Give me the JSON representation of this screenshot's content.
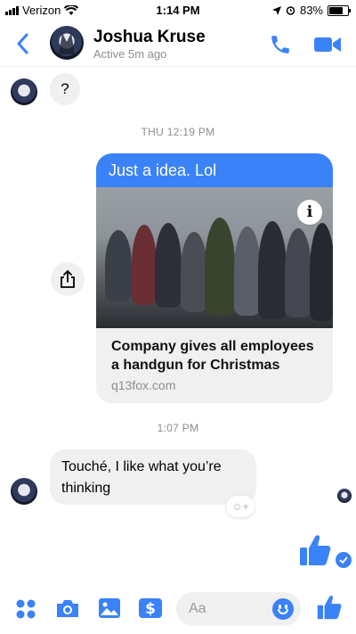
{
  "status_bar": {
    "carrier": "Verizon",
    "time": "1:14 PM",
    "battery": "83%",
    "battery_level": 0.83
  },
  "header": {
    "contact_name": "Joshua Kruse",
    "contact_status": "Active 5m ago"
  },
  "messages": {
    "incoming_question": "?",
    "timestamp_1": "THU 12:19 PM",
    "link_card": {
      "text": "Just a idea. Lol",
      "title": "Company gives all employees a handgun for Christmas",
      "domain": "q13fox.com"
    },
    "timestamp_2": "1:07 PM",
    "reply": "Touché, I like what you’re thinking"
  },
  "composer": {
    "placeholder": "Aa"
  },
  "colors": {
    "accent": "#3a82f7",
    "bubble_gray": "#f0f0f0",
    "muted_text": "#8e8e93"
  },
  "icons": [
    "back-chevron-icon",
    "phone-icon",
    "video-camera-icon",
    "share-icon",
    "info-icon",
    "add-reaction-icon",
    "thumbs-up-icon",
    "checkmark-icon",
    "apps-grid-icon",
    "camera-icon",
    "photo-icon",
    "payment-icon",
    "emoji-icon"
  ]
}
